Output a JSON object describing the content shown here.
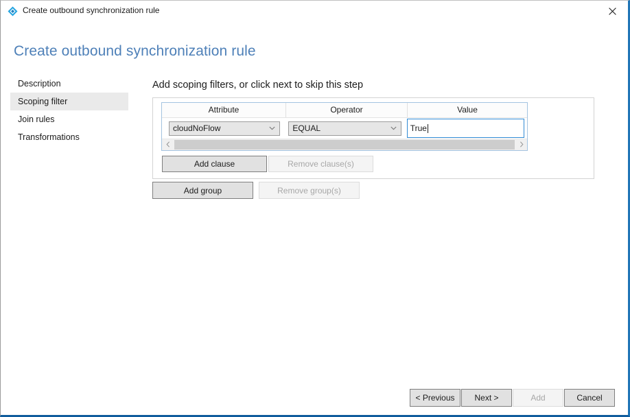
{
  "window": {
    "titlebar_title": "Create outbound synchronization rule",
    "app_icon": "sync-rule-diamond-icon",
    "close_icon": "close-icon",
    "accent_color": "#1f74b6"
  },
  "page": {
    "title": "Create outbound synchronization rule",
    "title_color": "#4e80b8"
  },
  "sidebar": {
    "items": [
      {
        "label": "Description",
        "selected": false
      },
      {
        "label": "Scoping filter",
        "selected": true
      },
      {
        "label": "Join rules",
        "selected": false
      },
      {
        "label": "Transformations",
        "selected": false
      }
    ],
    "selected_background": "#eaeaea"
  },
  "main": {
    "heading": "Add scoping filters, or click next to skip this step",
    "clause_table": {
      "columns": [
        "Attribute",
        "Operator",
        "Value"
      ],
      "rows": [
        {
          "attribute": "cloudNoFlow",
          "attribute_control": "combobox",
          "operator": "EQUAL",
          "operator_control": "combobox",
          "value": "True",
          "value_control": "textbox",
          "value_focused": true
        }
      ],
      "scrollbar": {
        "left_arrow_icon": "chevron-left-icon",
        "right_arrow_icon": "chevron-right-icon",
        "orientation": "horizontal"
      },
      "dropdown_icon": "chevron-down-icon",
      "focus_border_color": "#2f8ad4"
    },
    "clause_buttons": [
      {
        "label": "Add clause",
        "enabled": true
      },
      {
        "label": "Remove clause(s)",
        "enabled": false
      }
    ],
    "group_buttons": [
      {
        "label": "Add group",
        "enabled": true
      },
      {
        "label": "Remove group(s)",
        "enabled": false
      }
    ]
  },
  "footer": {
    "buttons": [
      {
        "label": "< Previous",
        "enabled": true
      },
      {
        "label": "Next >",
        "enabled": true
      },
      {
        "label": "Add",
        "enabled": false
      },
      {
        "label": "Cancel",
        "enabled": true
      }
    ]
  }
}
